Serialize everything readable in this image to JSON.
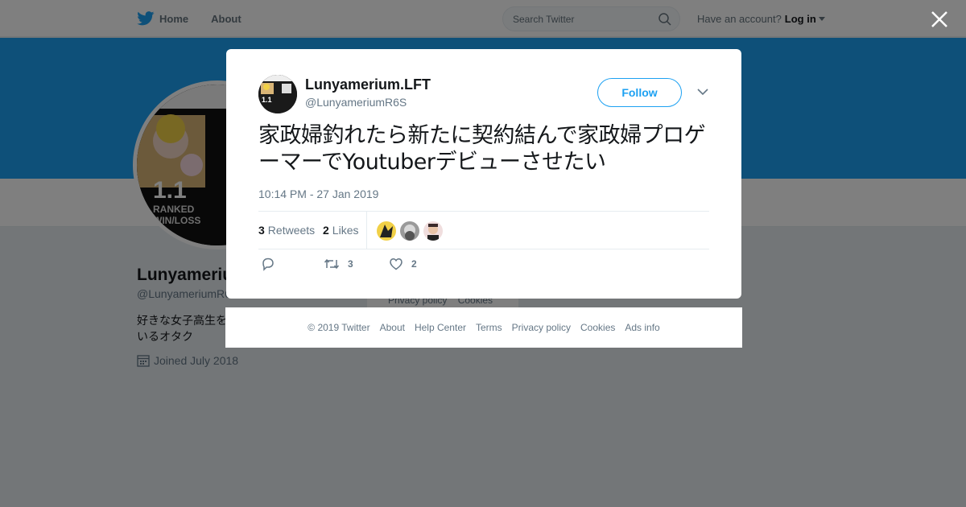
{
  "nav": {
    "home_label": "Home",
    "about_label": "About",
    "search_placeholder": "Search Twitter",
    "account_prompt": "Have an account?",
    "login_label": "Log in"
  },
  "profile": {
    "name": "Lunyamerium.LFT",
    "handle": "@LunyameriumR6S",
    "bio": "好きな女子高生を\nいるオタク",
    "joined": "Joined July 2018",
    "avatar_text": "1.1",
    "avatar_sub": "RANKED WIN/LOSS",
    "background_footer_links": [
      "Privacy policy",
      "Cookies"
    ]
  },
  "tweet": {
    "fullname": "Lunyamerium.LFT",
    "username": "@LunyameriumR6S",
    "follow_label": "Follow",
    "text": "家政婦釣れたら新たに契約結んで家政婦プロゲーマーでYoutuberデビューさせたい",
    "timestamp": "10:14 PM - 27 Jan 2019",
    "retweets_count": "3",
    "retweets_label": "Retweets",
    "likes_count": "2",
    "likes_label": "Likes",
    "action_retweet_count": "3",
    "action_like_count": "2",
    "avatar_text": "1.1"
  },
  "footer": {
    "links": [
      "© 2019 Twitter",
      "About",
      "Help Center",
      "Terms",
      "Privacy policy",
      "Cookies",
      "Ads info"
    ]
  },
  "colors": {
    "accent": "#1da1f2",
    "overlay": "rgba(0,0,0,0.5)"
  }
}
